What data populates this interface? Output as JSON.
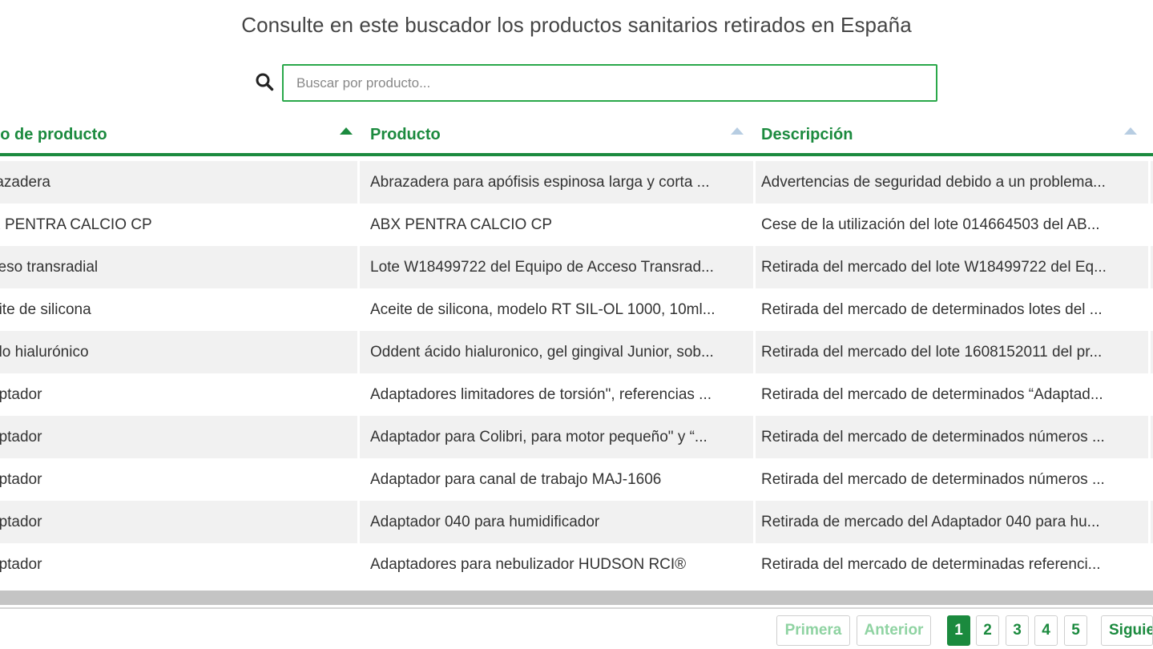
{
  "heading": "Consulte en este buscador los productos sanitarios retirados en España",
  "search": {
    "placeholder": "Buscar por producto..."
  },
  "table": {
    "headers": [
      "po de producto",
      "Producto",
      "Descripción"
    ],
    "rows": [
      [
        "razadera",
        "Abrazadera para apófisis espinosa larga y corta ...",
        "Advertencias de seguridad debido a un problema..."
      ],
      [
        "X PENTRA CALCIO CP",
        "ABX PENTRA CALCIO CP",
        "Cese de la utilización del lote 014664503 del AB..."
      ],
      [
        "ceso transradial",
        "Lote W18499722 del Equipo de Acceso Transrad...",
        "Retirada del mercado del lote W18499722 del Eq..."
      ],
      [
        "eite de silicona",
        "Aceite de silicona, modelo RT SIL-OL 1000, 10ml...",
        "Retirada del mercado de determinados lotes del ..."
      ],
      [
        "ido hialurónico",
        "Oddent ácido hialuronico, gel gingival Junior, sob...",
        "Retirada del mercado del lote 1608152011 del pr..."
      ],
      [
        "aptador",
        "Adaptadores limitadores de torsión\", referencias ...",
        "Retirada del mercado de determinados “Adaptad..."
      ],
      [
        "aptador",
        "Adaptador para Colibri, para motor pequeño\" y “...",
        "Retirada del mercado de determinados números ..."
      ],
      [
        "aptador",
        "Adaptador para canal de trabajo MAJ-1606",
        "Retirada del mercado de determinados números ..."
      ],
      [
        "aptador",
        "Adaptador 040 para humidificador",
        "Retirada de mercado del Adaptador 040 para hu..."
      ],
      [
        "aptador",
        "Adaptadores para nebulizador HUDSON RCI®",
        "Retirada del mercado de determinadas referenci..."
      ]
    ]
  },
  "pagination": {
    "first": "Primera",
    "prev": "Anterior",
    "pages": [
      "1",
      "2",
      "3",
      "4",
      "5"
    ],
    "current_page": "1",
    "next": "Siguie"
  },
  "colors": {
    "accent": "#1b8a3e",
    "search_border": "#2aa84a"
  },
  "icons": {
    "search": "search-icon",
    "sort": "sort-arrow-icon"
  }
}
